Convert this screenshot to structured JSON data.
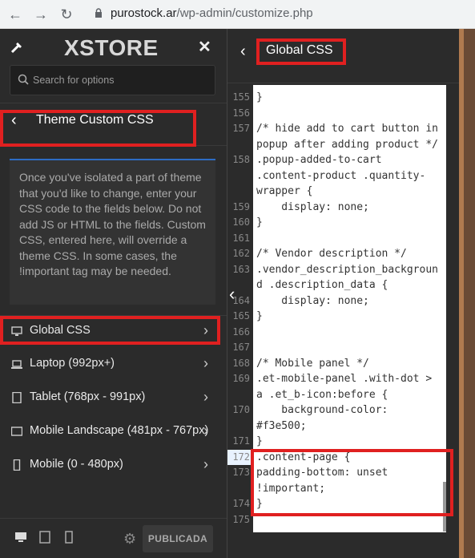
{
  "browser": {
    "url_domain": "purostock.ar",
    "url_path": "/wp-admin/customize.php"
  },
  "sidebar": {
    "logo": "XSTORE",
    "search_placeholder": "Search for options",
    "section_title": "Theme Custom CSS",
    "description": "Once you've isolated a part of theme that you'd like to change, enter your CSS code to the fields below. Do not add JS or HTML to the fields. Custom CSS, entered here, will override a theme CSS. In some cases, the !important tag may be needed.",
    "items": [
      {
        "label": "Global CSS",
        "icon": "desktop-icon"
      },
      {
        "label": "Laptop (992px+)",
        "icon": "laptop-icon"
      },
      {
        "label": "Tablet (768px - 991px)",
        "icon": "tablet-icon"
      },
      {
        "label": "Mobile Landscape (481px - 767px)",
        "icon": "tablet-landscape-icon"
      },
      {
        "label": "Mobile (0 - 480px)",
        "icon": "mobile-icon"
      }
    ],
    "publish_label": "PUBLICADA"
  },
  "panel": {
    "title": "Global CSS",
    "code_lines": [
      {
        "n": "155",
        "rows": [
          "}"
        ]
      },
      {
        "n": "156",
        "rows": [
          ""
        ]
      },
      {
        "n": "157",
        "rows": [
          "/* hide add to cart button in",
          "popup after adding product */"
        ]
      },
      {
        "n": "158",
        "rows": [
          ".popup-added-to-cart",
          ".content-product .quantity-",
          "wrapper {"
        ]
      },
      {
        "n": "159",
        "rows": [
          "    display: none;"
        ]
      },
      {
        "n": "160",
        "rows": [
          "}"
        ]
      },
      {
        "n": "161",
        "rows": [
          ""
        ]
      },
      {
        "n": "162",
        "rows": [
          "/* Vendor description */"
        ]
      },
      {
        "n": "163",
        "rows": [
          ".vendor_description_backgroun",
          "d .description_data {"
        ]
      },
      {
        "n": "164",
        "rows": [
          "    display: none;"
        ]
      },
      {
        "n": "165",
        "rows": [
          "}"
        ]
      },
      {
        "n": "166",
        "rows": [
          ""
        ]
      },
      {
        "n": "167",
        "rows": [
          ""
        ]
      },
      {
        "n": "168",
        "rows": [
          "/* Mobile panel */"
        ]
      },
      {
        "n": "169",
        "rows": [
          ".et-mobile-panel .with-dot >",
          "a .et_b-icon:before {"
        ]
      },
      {
        "n": "170",
        "rows": [
          "    background-color:",
          "#f3e500;"
        ]
      },
      {
        "n": "171",
        "rows": [
          "}"
        ]
      },
      {
        "n": "172",
        "rows": [
          ".content-page {"
        ]
      },
      {
        "n": "173",
        "rows": [
          "padding-bottom: unset",
          "!important;"
        ]
      },
      {
        "n": "174",
        "rows": [
          "}"
        ]
      },
      {
        "n": "175",
        "rows": [
          ""
        ]
      }
    ]
  }
}
